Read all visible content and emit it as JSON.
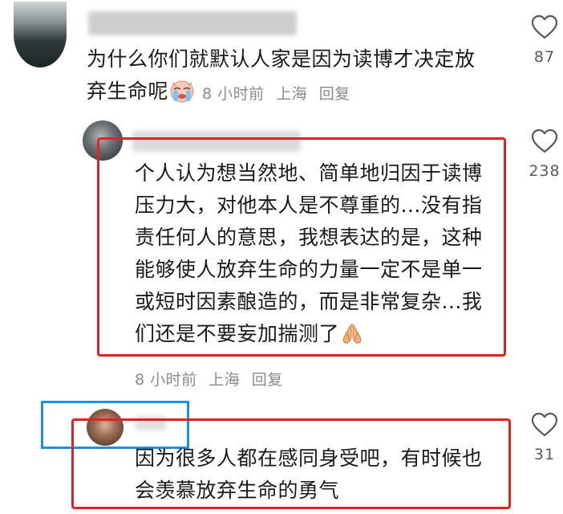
{
  "comments": [
    {
      "line1": "为什么你们就默认人家是因为读博才决定放",
      "line2": "弃生命呢",
      "emoji": "crying-face-icon",
      "time": "8 小时前",
      "location": "上海",
      "reply_label": "回复",
      "likes": "87"
    },
    {
      "lines": [
        "个人认为想当然地、简单地归因于读博",
        "压力大，对他本人是不尊重的...没有指",
        "责任何人的意思，我想表达的是，这种",
        "能够使人放弃生命的力量一定不是单一",
        "或短时因素酿造的，而是非常复杂...我",
        "们还是不要妄加揣测了"
      ],
      "emoji": "folded-hands-icon",
      "time": "8 小时前",
      "location": "上海",
      "reply_label": "回复",
      "likes": "238"
    },
    {
      "lines": [
        "因为很多人都在感同身受吧，有时候也",
        "会羡慕放弃生命的勇气"
      ],
      "likes": "31"
    }
  ],
  "colors": {
    "highlight_red": "#e02424",
    "highlight_blue": "#1f8fe0",
    "meta_gray": "#8a8a8a"
  }
}
